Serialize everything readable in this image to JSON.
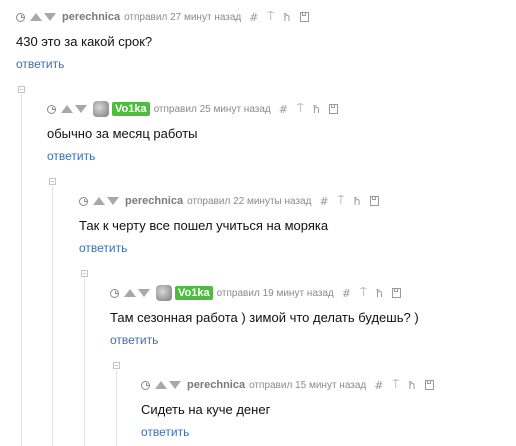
{
  "action_icons": [
    "hash-icon",
    "pin-icon",
    "flag-icon",
    "save-icon"
  ],
  "action_glyphs": {
    "hash": "#",
    "pin": "⍑",
    "flag": "ħ"
  },
  "comments": [
    {
      "author": "perechnica",
      "meta": "отправил 27 минут назад",
      "text": "430 это за какой срок?",
      "reply": "ответить"
    },
    {
      "author": "Vo1ka",
      "meta": "отправил 25 минут назад",
      "text": "обычно за месяц работы",
      "reply": "ответить"
    },
    {
      "author": "perechnica",
      "meta": "отправил 22 минуты назад",
      "text": "Так к черту все пошел учиться на моряка",
      "reply": "ответить"
    },
    {
      "author": "Vo1ka",
      "meta": "отправил 19 минут назад",
      "text": "Там сезонная работа ) зимой что делать будешь? )",
      "reply": "ответить"
    },
    {
      "author": "perechnica",
      "meta": "отправил 15 минут назад",
      "text": "Сидеть на куче денег",
      "reply": "ответить"
    }
  ]
}
